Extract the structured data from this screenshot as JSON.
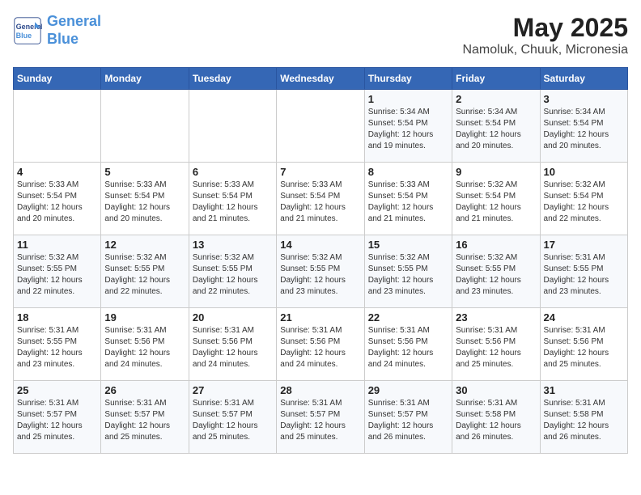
{
  "header": {
    "logo_line1": "General",
    "logo_line2": "Blue",
    "title": "May 2025",
    "subtitle": "Namoluk, Chuuk, Micronesia"
  },
  "weekdays": [
    "Sunday",
    "Monday",
    "Tuesday",
    "Wednesday",
    "Thursday",
    "Friday",
    "Saturday"
  ],
  "weeks": [
    [
      {
        "day": "",
        "info": ""
      },
      {
        "day": "",
        "info": ""
      },
      {
        "day": "",
        "info": ""
      },
      {
        "day": "",
        "info": ""
      },
      {
        "day": "1",
        "info": "Sunrise: 5:34 AM\nSunset: 5:54 PM\nDaylight: 12 hours\nand 19 minutes."
      },
      {
        "day": "2",
        "info": "Sunrise: 5:34 AM\nSunset: 5:54 PM\nDaylight: 12 hours\nand 20 minutes."
      },
      {
        "day": "3",
        "info": "Sunrise: 5:34 AM\nSunset: 5:54 PM\nDaylight: 12 hours\nand 20 minutes."
      }
    ],
    [
      {
        "day": "4",
        "info": "Sunrise: 5:33 AM\nSunset: 5:54 PM\nDaylight: 12 hours\nand 20 minutes."
      },
      {
        "day": "5",
        "info": "Sunrise: 5:33 AM\nSunset: 5:54 PM\nDaylight: 12 hours\nand 20 minutes."
      },
      {
        "day": "6",
        "info": "Sunrise: 5:33 AM\nSunset: 5:54 PM\nDaylight: 12 hours\nand 21 minutes."
      },
      {
        "day": "7",
        "info": "Sunrise: 5:33 AM\nSunset: 5:54 PM\nDaylight: 12 hours\nand 21 minutes."
      },
      {
        "day": "8",
        "info": "Sunrise: 5:33 AM\nSunset: 5:54 PM\nDaylight: 12 hours\nand 21 minutes."
      },
      {
        "day": "9",
        "info": "Sunrise: 5:32 AM\nSunset: 5:54 PM\nDaylight: 12 hours\nand 21 minutes."
      },
      {
        "day": "10",
        "info": "Sunrise: 5:32 AM\nSunset: 5:54 PM\nDaylight: 12 hours\nand 22 minutes."
      }
    ],
    [
      {
        "day": "11",
        "info": "Sunrise: 5:32 AM\nSunset: 5:55 PM\nDaylight: 12 hours\nand 22 minutes."
      },
      {
        "day": "12",
        "info": "Sunrise: 5:32 AM\nSunset: 5:55 PM\nDaylight: 12 hours\nand 22 minutes."
      },
      {
        "day": "13",
        "info": "Sunrise: 5:32 AM\nSunset: 5:55 PM\nDaylight: 12 hours\nand 22 minutes."
      },
      {
        "day": "14",
        "info": "Sunrise: 5:32 AM\nSunset: 5:55 PM\nDaylight: 12 hours\nand 23 minutes."
      },
      {
        "day": "15",
        "info": "Sunrise: 5:32 AM\nSunset: 5:55 PM\nDaylight: 12 hours\nand 23 minutes."
      },
      {
        "day": "16",
        "info": "Sunrise: 5:32 AM\nSunset: 5:55 PM\nDaylight: 12 hours\nand 23 minutes."
      },
      {
        "day": "17",
        "info": "Sunrise: 5:31 AM\nSunset: 5:55 PM\nDaylight: 12 hours\nand 23 minutes."
      }
    ],
    [
      {
        "day": "18",
        "info": "Sunrise: 5:31 AM\nSunset: 5:55 PM\nDaylight: 12 hours\nand 23 minutes."
      },
      {
        "day": "19",
        "info": "Sunrise: 5:31 AM\nSunset: 5:56 PM\nDaylight: 12 hours\nand 24 minutes."
      },
      {
        "day": "20",
        "info": "Sunrise: 5:31 AM\nSunset: 5:56 PM\nDaylight: 12 hours\nand 24 minutes."
      },
      {
        "day": "21",
        "info": "Sunrise: 5:31 AM\nSunset: 5:56 PM\nDaylight: 12 hours\nand 24 minutes."
      },
      {
        "day": "22",
        "info": "Sunrise: 5:31 AM\nSunset: 5:56 PM\nDaylight: 12 hours\nand 24 minutes."
      },
      {
        "day": "23",
        "info": "Sunrise: 5:31 AM\nSunset: 5:56 PM\nDaylight: 12 hours\nand 25 minutes."
      },
      {
        "day": "24",
        "info": "Sunrise: 5:31 AM\nSunset: 5:56 PM\nDaylight: 12 hours\nand 25 minutes."
      }
    ],
    [
      {
        "day": "25",
        "info": "Sunrise: 5:31 AM\nSunset: 5:57 PM\nDaylight: 12 hours\nand 25 minutes."
      },
      {
        "day": "26",
        "info": "Sunrise: 5:31 AM\nSunset: 5:57 PM\nDaylight: 12 hours\nand 25 minutes."
      },
      {
        "day": "27",
        "info": "Sunrise: 5:31 AM\nSunset: 5:57 PM\nDaylight: 12 hours\nand 25 minutes."
      },
      {
        "day": "28",
        "info": "Sunrise: 5:31 AM\nSunset: 5:57 PM\nDaylight: 12 hours\nand 25 minutes."
      },
      {
        "day": "29",
        "info": "Sunrise: 5:31 AM\nSunset: 5:57 PM\nDaylight: 12 hours\nand 26 minutes."
      },
      {
        "day": "30",
        "info": "Sunrise: 5:31 AM\nSunset: 5:58 PM\nDaylight: 12 hours\nand 26 minutes."
      },
      {
        "day": "31",
        "info": "Sunrise: 5:31 AM\nSunset: 5:58 PM\nDaylight: 12 hours\nand 26 minutes."
      }
    ]
  ]
}
